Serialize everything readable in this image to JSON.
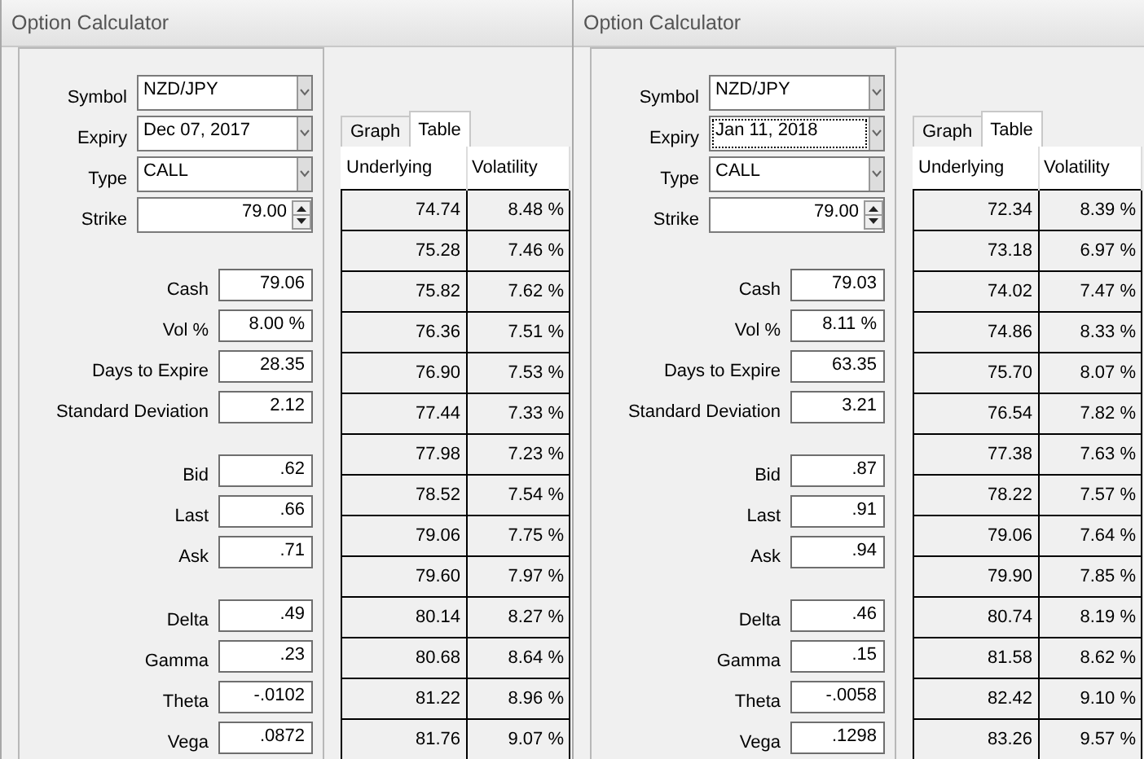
{
  "windows": [
    {
      "title": "Option Calculator",
      "inputs": [
        {
          "kind": "combo",
          "label": "Symbol",
          "value": "NZD/JPY",
          "focused": false
        },
        {
          "kind": "combo",
          "label": "Expiry",
          "value": "Dec 07, 2017",
          "focused": false
        },
        {
          "kind": "combo",
          "label": "Type",
          "value": "CALL",
          "focused": false
        },
        {
          "kind": "spinner",
          "label": "Strike",
          "value": "79.00",
          "focused": false
        }
      ],
      "field_groups": [
        [
          {
            "label": "Cash",
            "value": "79.06"
          },
          {
            "label": "Vol %",
            "value": "8.00 %"
          },
          {
            "label": "Days to Expire",
            "value": "28.35"
          },
          {
            "label": "Standard Deviation",
            "value": "2.12"
          }
        ],
        [
          {
            "label": "Bid",
            "value": ".62"
          },
          {
            "label": "Last",
            "value": ".66"
          },
          {
            "label": "Ask",
            "value": ".71"
          }
        ],
        [
          {
            "label": "Delta",
            "value": ".49"
          },
          {
            "label": "Gamma",
            "value": ".23"
          },
          {
            "label": "Theta",
            "value": "-.0102"
          },
          {
            "label": "Vega",
            "value": ".0872"
          }
        ]
      ],
      "tabs": [
        {
          "label": "Graph",
          "selected": false
        },
        {
          "label": "Table",
          "selected": true
        }
      ],
      "table": {
        "columns": [
          "Underlying",
          "Volatility"
        ],
        "rows": [
          [
            "74.74",
            "8.48 %"
          ],
          [
            "75.28",
            "7.46 %"
          ],
          [
            "75.82",
            "7.62 %"
          ],
          [
            "76.36",
            "7.51 %"
          ],
          [
            "76.90",
            "7.53 %"
          ],
          [
            "77.44",
            "7.33 %"
          ],
          [
            "77.98",
            "7.23 %"
          ],
          [
            "78.52",
            "7.54 %"
          ],
          [
            "79.06",
            "7.75 %"
          ],
          [
            "79.60",
            "7.97 %"
          ],
          [
            "80.14",
            "8.27 %"
          ],
          [
            "80.68",
            "8.64 %"
          ],
          [
            "81.22",
            "8.96 %"
          ],
          [
            "81.76",
            "9.07 %"
          ]
        ]
      }
    },
    {
      "title": "Option Calculator",
      "inputs": [
        {
          "kind": "combo",
          "label": "Symbol",
          "value": "NZD/JPY",
          "focused": false
        },
        {
          "kind": "combo",
          "label": "Expiry",
          "value": "Jan 11, 2018",
          "focused": true
        },
        {
          "kind": "combo",
          "label": "Type",
          "value": "CALL",
          "focused": false
        },
        {
          "kind": "spinner",
          "label": "Strike",
          "value": "79.00",
          "focused": false
        }
      ],
      "field_groups": [
        [
          {
            "label": "Cash",
            "value": "79.03"
          },
          {
            "label": "Vol %",
            "value": "8.11 %"
          },
          {
            "label": "Days to Expire",
            "value": "63.35"
          },
          {
            "label": "Standard Deviation",
            "value": "3.21"
          }
        ],
        [
          {
            "label": "Bid",
            "value": ".87"
          },
          {
            "label": "Last",
            "value": ".91"
          },
          {
            "label": "Ask",
            "value": ".94"
          }
        ],
        [
          {
            "label": "Delta",
            "value": ".46"
          },
          {
            "label": "Gamma",
            "value": ".15"
          },
          {
            "label": "Theta",
            "value": "-.0058"
          },
          {
            "label": "Vega",
            "value": ".1298"
          }
        ]
      ],
      "tabs": [
        {
          "label": "Graph",
          "selected": false
        },
        {
          "label": "Table",
          "selected": true
        }
      ],
      "table": {
        "columns": [
          "Underlying",
          "Volatility"
        ],
        "rows": [
          [
            "72.34",
            "8.39 %"
          ],
          [
            "73.18",
            "6.97 %"
          ],
          [
            "74.02",
            "7.47 %"
          ],
          [
            "74.86",
            "8.33 %"
          ],
          [
            "75.70",
            "8.07 %"
          ],
          [
            "76.54",
            "7.82 %"
          ],
          [
            "77.38",
            "7.63 %"
          ],
          [
            "78.22",
            "7.57 %"
          ],
          [
            "79.06",
            "7.64 %"
          ],
          [
            "79.90",
            "7.85 %"
          ],
          [
            "80.74",
            "8.19 %"
          ],
          [
            "81.58",
            "8.62 %"
          ],
          [
            "82.42",
            "9.10 %"
          ],
          [
            "83.26",
            "9.57 %"
          ]
        ]
      }
    }
  ]
}
